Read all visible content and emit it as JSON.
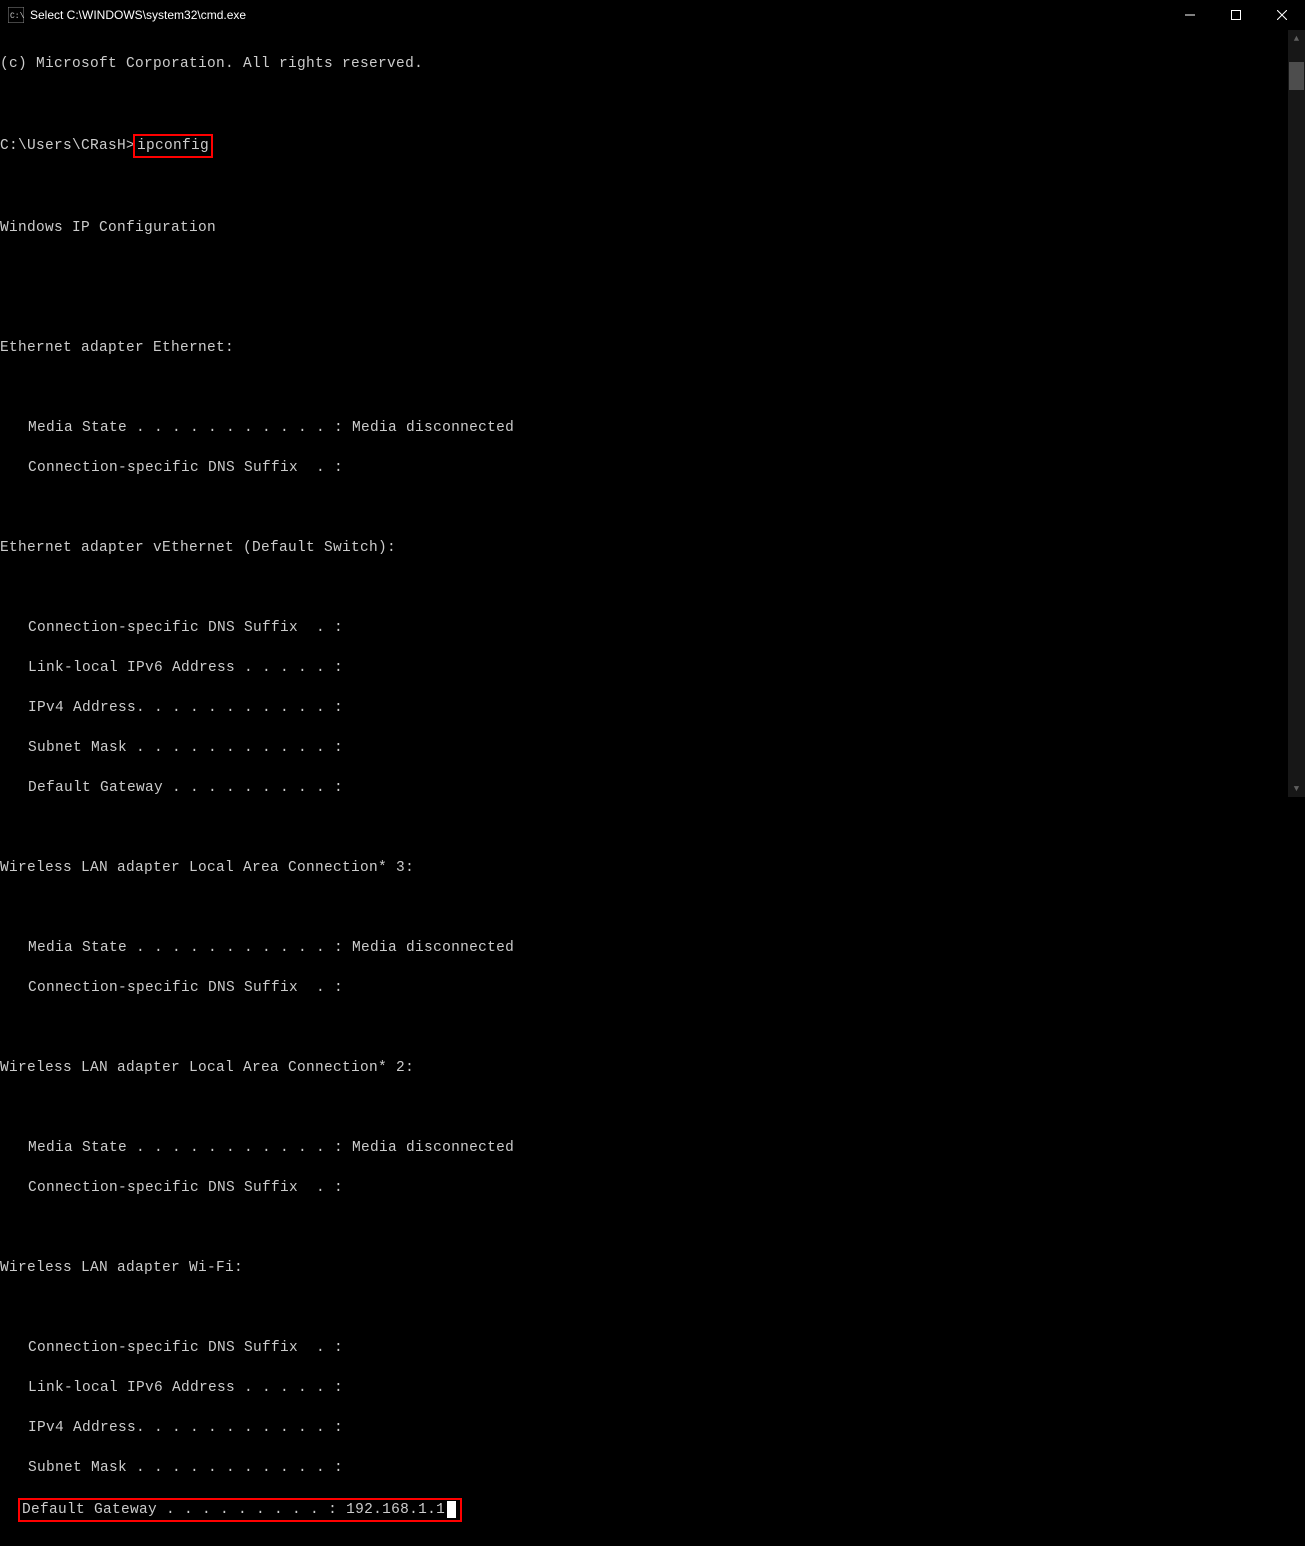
{
  "titlebar": {
    "title": "Select C:\\WINDOWS\\system32\\cmd.exe"
  },
  "terminal": {
    "copyright": "(c) Microsoft Corporation. All rights reserved.",
    "prompt_prefix": "C:\\Users\\CRasH>",
    "command": "ipconfig",
    "header": "Windows IP Configuration",
    "sections": [
      {
        "title": "Ethernet adapter Ethernet:",
        "lines": [
          "Media State . . . . . . . . . . . : Media disconnected",
          "Connection-specific DNS Suffix  . :"
        ]
      },
      {
        "title": "Ethernet adapter vEthernet (Default Switch):",
        "lines": [
          "Connection-specific DNS Suffix  . :",
          "Link-local IPv6 Address . . . . . :",
          "IPv4 Address. . . . . . . . . . . :",
          "Subnet Mask . . . . . . . . . . . :",
          "Default Gateway . . . . . . . . . :"
        ]
      },
      {
        "title": "Wireless LAN adapter Local Area Connection* 3:",
        "lines": [
          "Media State . . . . . . . . . . . : Media disconnected",
          "Connection-specific DNS Suffix  . :"
        ]
      },
      {
        "title": "Wireless LAN adapter Local Area Connection* 2:",
        "lines": [
          "Media State . . . . . . . . . . . : Media disconnected",
          "Connection-specific DNS Suffix  . :"
        ]
      },
      {
        "title": "Wireless LAN adapter Wi-Fi:",
        "lines": [
          "Connection-specific DNS Suffix  . :",
          "Link-local IPv6 Address . . . . . :",
          "IPv4 Address. . . . . . . . . . . :",
          "Subnet Mask . . . . . . . . . . . :"
        ],
        "highlighted_line": "Default Gateway . . . . . . . . . : 192.168.1.1"
      }
    ]
  }
}
